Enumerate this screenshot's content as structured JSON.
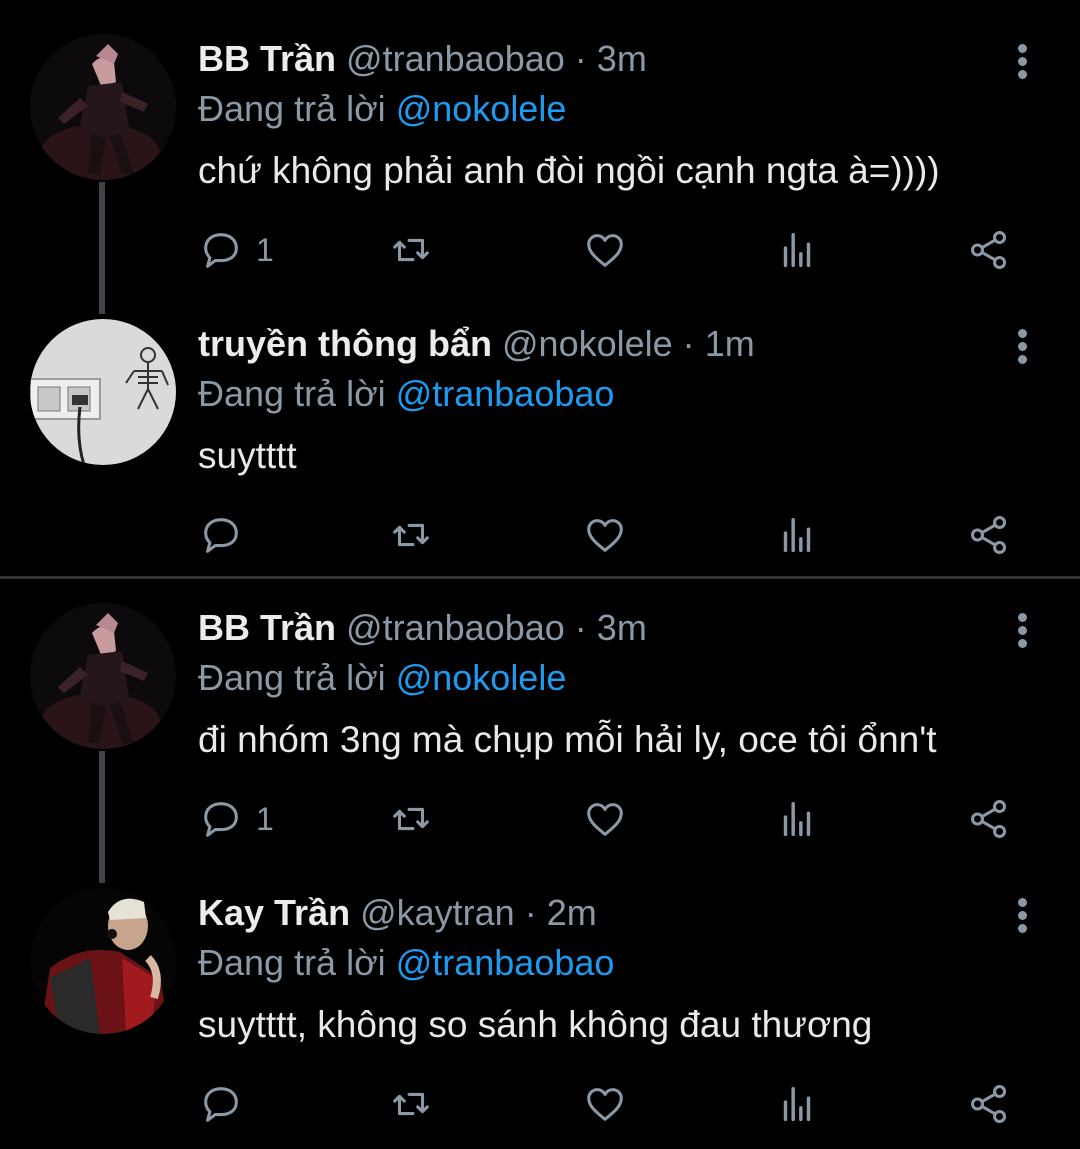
{
  "tweets": [
    {
      "name": "BB Trần",
      "handle": "@tranbaobao",
      "separator": "·",
      "time": "3m",
      "replying_prefix": "Đang trả lời",
      "replying_to": "@nokolele",
      "text": "chứ không phải anh đòi ngồi cạnh ngta à=))))",
      "reply_count": "1",
      "avatar": "dark-performer-photo"
    },
    {
      "name": "truyền thông bẩn",
      "handle": "@nokolele",
      "separator": "·",
      "time": "1m",
      "replying_prefix": "Đang trả lời",
      "replying_to": "@tranbaobao",
      "text": "suytttt",
      "reply_count": "",
      "avatar": "wall-outlet-skeleton-photo"
    },
    {
      "name": "BB Trần",
      "handle": "@tranbaobao",
      "separator": "·",
      "time": "3m",
      "replying_prefix": "Đang trả lời",
      "replying_to": "@nokolele",
      "text": "đi nhóm 3ng mà chụp mỗi hải ly, oce tôi ổnn't",
      "reply_count": "1",
      "avatar": "dark-performer-photo"
    },
    {
      "name": "Kay Trần",
      "handle": "@kaytran",
      "separator": "·",
      "time": "2m",
      "replying_prefix": "Đang trả lời",
      "replying_to": "@tranbaobao",
      "text": "suytttt, không so sánh không đau thương",
      "reply_count": "",
      "avatar": "red-jacket-portrait-photo"
    }
  ],
  "icons": [
    "reply-icon",
    "retweet-icon",
    "like-icon",
    "analytics-icon",
    "share-icon",
    "more-options-icon"
  ],
  "colors": {
    "background": "#000000",
    "mention": "#1d9bf0",
    "muted": "#8b98a5",
    "text": "#e7e9ea"
  }
}
